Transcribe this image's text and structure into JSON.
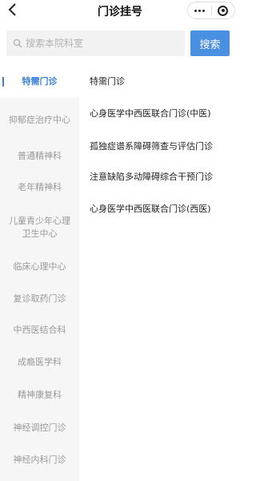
{
  "navbar": {
    "title": "门诊挂号"
  },
  "search": {
    "placeholder": "搜索本院科室",
    "value": "",
    "button_label": "搜索"
  },
  "sidebar": {
    "items": [
      {
        "label": "特需门诊",
        "active": true
      },
      {
        "label": "抑郁症治疗中心",
        "active": false
      },
      {
        "label": "普通精神科",
        "active": false
      },
      {
        "label": "老年精神科",
        "active": false
      },
      {
        "label": "儿童青少年心理卫生中心",
        "active": false
      },
      {
        "label": "临床心理中心",
        "active": false
      },
      {
        "label": "复诊取药门诊",
        "active": false
      },
      {
        "label": "中西医结合科",
        "active": false
      },
      {
        "label": "成瘾医学科",
        "active": false
      },
      {
        "label": "精神康复科",
        "active": false
      },
      {
        "label": "神经调控门诊",
        "active": false
      },
      {
        "label": "神经内科门诊",
        "active": false
      }
    ]
  },
  "departments": [
    "特需门诊",
    "心身医学中西医联合门诊(中医)",
    "孤独症谱系障碍筛查与评估门诊",
    "注意缺陷多动障碍综合干预门诊",
    "心身医学中西医联合门诊(西医)"
  ],
  "colors": {
    "accent": "#3b82d6",
    "search_button": "#4a90e2",
    "sidebar_bg": "#f6f6f6"
  }
}
